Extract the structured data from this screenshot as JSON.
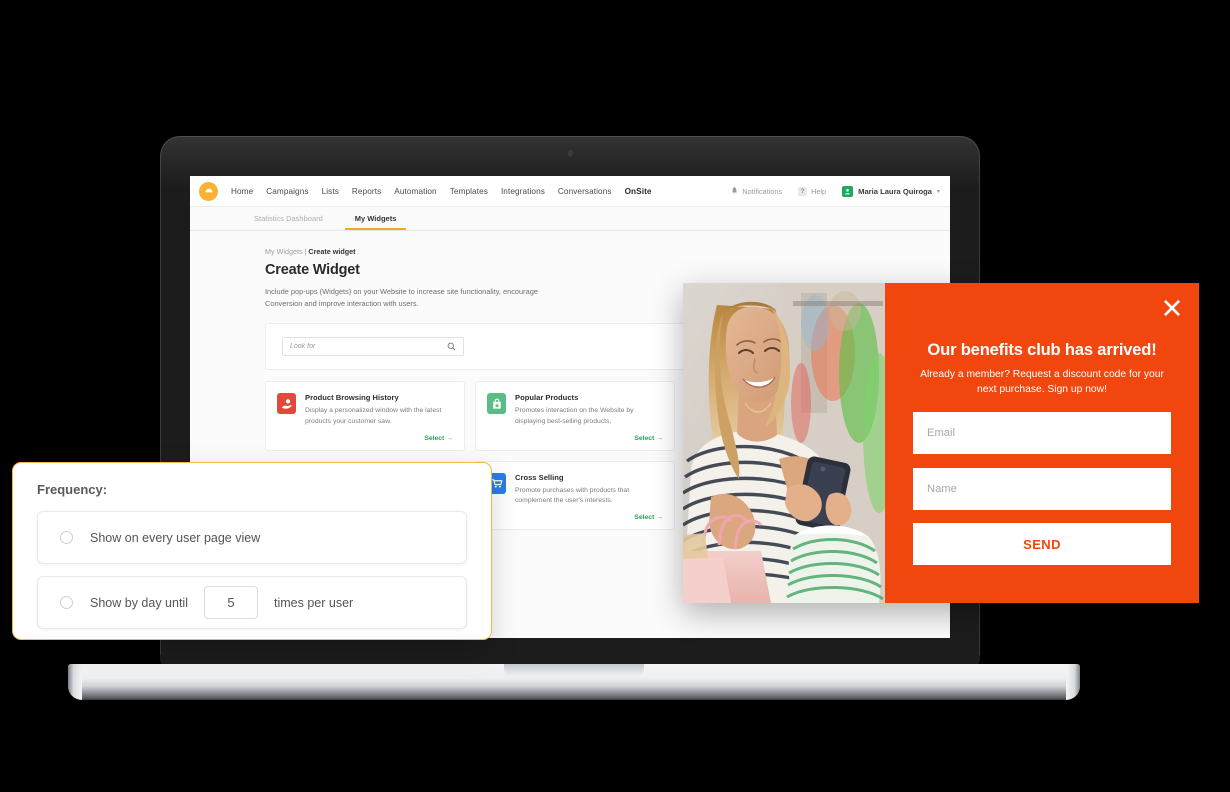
{
  "app": {
    "brand_icon": "smile-logo-icon",
    "brand_color": "#f9b233"
  },
  "navbar": {
    "links": [
      {
        "label": "Home",
        "active": false
      },
      {
        "label": "Campaigns",
        "active": false
      },
      {
        "label": "Lists",
        "active": false
      },
      {
        "label": "Reports",
        "active": false
      },
      {
        "label": "Automation",
        "active": false
      },
      {
        "label": "Templates",
        "active": false
      },
      {
        "label": "Integrations",
        "active": false
      },
      {
        "label": "Conversations",
        "active": false
      },
      {
        "label": "OnSite",
        "active": true
      }
    ],
    "notifications_label": "Notifications",
    "help_label": "Help",
    "help_glyph": "?",
    "user_name": "Maria Laura Quiroga",
    "caret_glyph": "▾"
  },
  "subnav": {
    "tabs": [
      {
        "label": "Statistics Dashboard",
        "active": false
      },
      {
        "label": "My Widgets",
        "active": true
      }
    ],
    "active_underline_color": "#f5a623"
  },
  "page": {
    "breadcrumb_parent": "My Widgets",
    "breadcrumb_separator": " | ",
    "breadcrumb_current": "Create widget",
    "title": "Create Widget",
    "description": "Include pop-ups (Widgets) on your Website to increase site functionality, encourage Conversion and improve interaction with users."
  },
  "search": {
    "placeholder": "Look for",
    "value": "",
    "icon": "search-icon"
  },
  "widget_cards": [
    {
      "title": "Product Browsing History",
      "description": "Display a personalized window with the latest products your customer saw.",
      "select_label": "Select →",
      "icon": "browsing-history-icon",
      "icon_color": "#e04a3c"
    },
    {
      "title": "Popular Products",
      "description": "Promotes interaction on the Website by displaying best-selling products.",
      "select_label": "Select →",
      "icon": "shopping-bag-icon",
      "icon_color": "#5cbd84"
    },
    {
      "title": "Cross Selling",
      "description": "Promote purchases with products that complement the user's interests.",
      "select_label": "Select →",
      "icon": "shopping-cart-icon",
      "icon_color": "#2b7de9"
    }
  ],
  "frequency_panel": {
    "title": "Frequency:",
    "border_color": "#f2b949",
    "options": [
      {
        "label": "Show on every user page view",
        "selected": false
      },
      {
        "label": "Show by day until",
        "selected": false,
        "value": "5",
        "suffix": "times per user"
      }
    ]
  },
  "popup_widget": {
    "accent_color": "#f2460f",
    "close_icon": "close-icon",
    "headline": "Our benefits club has arrived!",
    "subtext": "Already a member? Request a discount code for your next purchase. Sign up now!",
    "email_placeholder": "Email",
    "email_value": "",
    "name_placeholder": "Name",
    "name_value": "",
    "send_label": "SEND",
    "photo_alt": "woman-shopping-with-phone-photo"
  }
}
